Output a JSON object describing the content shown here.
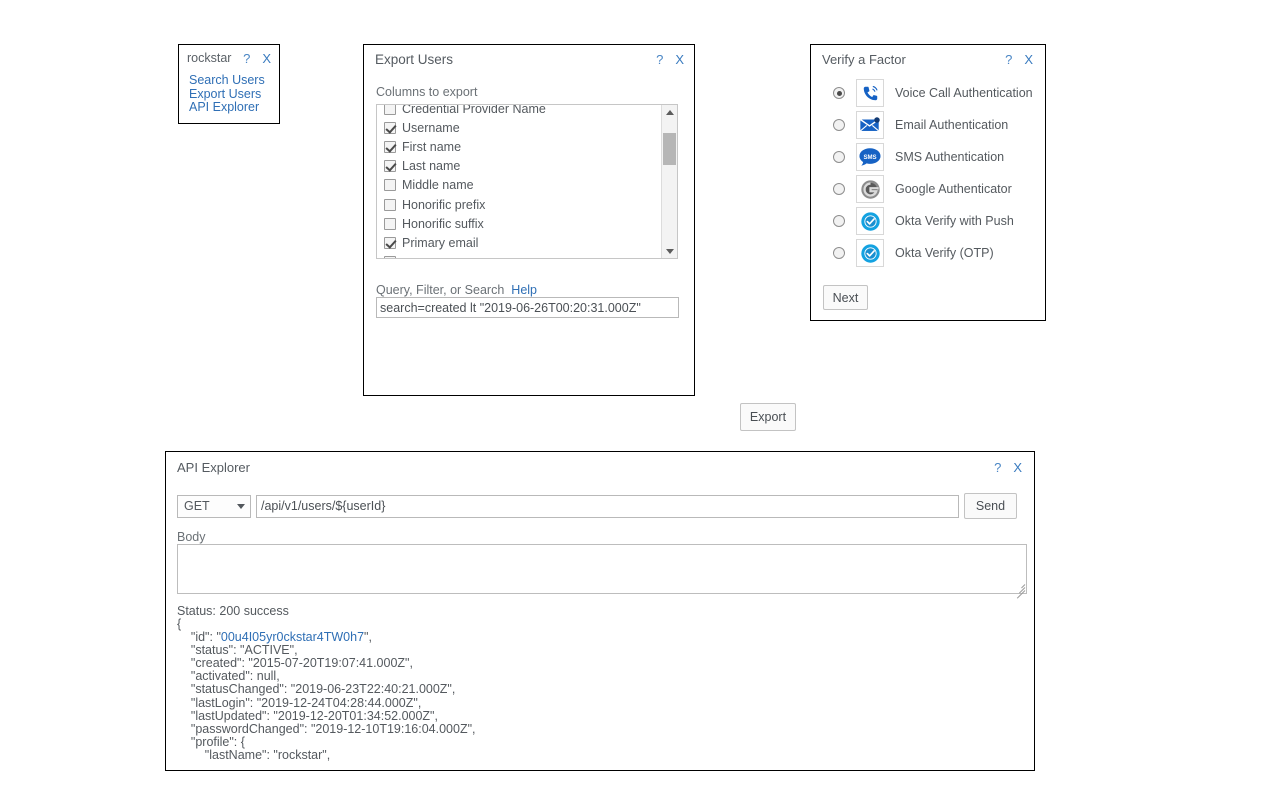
{
  "rockstar_menu": {
    "title": "rockstar",
    "help_label": "?",
    "close_label": "X",
    "items": [
      {
        "label": "Search Users",
        "name": "search-users"
      },
      {
        "label": "Export Users",
        "name": "export-users"
      },
      {
        "label": "API Explorer",
        "name": "api-explorer"
      }
    ]
  },
  "export_users": {
    "title": "Export Users",
    "help_label": "?",
    "close_label": "X",
    "columns_label": "Columns to export",
    "columns": [
      {
        "label": "Credential Provider Name",
        "checked": false
      },
      {
        "label": "Username",
        "checked": true
      },
      {
        "label": "First name",
        "checked": true
      },
      {
        "label": "Last name",
        "checked": true
      },
      {
        "label": "Middle name",
        "checked": false
      },
      {
        "label": "Honorific prefix",
        "checked": false
      },
      {
        "label": "Honorific suffix",
        "checked": false
      },
      {
        "label": "Primary email",
        "checked": true
      }
    ],
    "query_label": "Query, Filter, or Search",
    "query_help_label": "Help",
    "query_value": "search=created lt \"2019-06-26T00:20:31.000Z\"",
    "query_placeholder": "",
    "export_button_label": "Export"
  },
  "verify_factor": {
    "title": "Verify a Factor",
    "help_label": "?",
    "close_label": "X",
    "factors": [
      {
        "label": "Voice Call Authentication",
        "icon": "phone-call-icon",
        "selected": true
      },
      {
        "label": "Email Authentication",
        "icon": "email-envelope-icon",
        "selected": false
      },
      {
        "label": "SMS Authentication",
        "icon": "sms-bubble-icon",
        "selected": false
      },
      {
        "label": "Google Authenticator",
        "icon": "google-authenticator-icon",
        "selected": false
      },
      {
        "label": "Okta Verify with Push",
        "icon": "okta-verify-check-icon",
        "selected": false
      },
      {
        "label": "Okta Verify (OTP)",
        "icon": "okta-verify-check-icon",
        "selected": false
      }
    ],
    "next_button_label": "Next"
  },
  "api_explorer": {
    "title": "API Explorer",
    "help_label": "?",
    "close_label": "X",
    "method": "GET",
    "url_value": "/api/v1/users/${userId}",
    "url_placeholder": "",
    "send_button_label": "Send",
    "body_label": "Body",
    "body_value": "",
    "body_placeholder": "",
    "status_line": "Status: 200 success",
    "response_lines": [
      "{",
      "    \"id\": \"00u4I05yr0ckstar4TW0h7\",",
      "    \"status\": \"ACTIVE\",",
      "    \"created\": \"2015-07-20T19:07:41.000Z\",",
      "    \"activated\": null,",
      "    \"statusChanged\": \"2019-06-23T22:40:21.000Z\",",
      "    \"lastLogin\": \"2019-12-24T04:28:44.000Z\",",
      "    \"lastUpdated\": \"2019-12-20T01:34:52.000Z\",",
      "    \"passwordChanged\": \"2019-12-10T19:16:04.000Z\",",
      "    \"profile\": {",
      "        \"lastName\": \"rockstar\","
    ],
    "highlight_line_index": 1,
    "highlight_value": "00u4I05yr0ckstar4TW0h7"
  },
  "colors": {
    "link": "#2f6fb5",
    "text": "#54595e",
    "okta_blue": "#13a2e1",
    "sms_blue": "#1662c4"
  }
}
